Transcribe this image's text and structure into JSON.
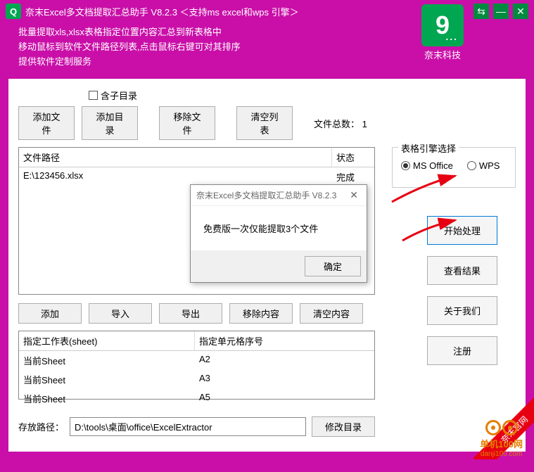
{
  "titlebar": {
    "title": "奈末Excel多文档提取汇总助手  V8.2.3  ＜支持ms  excel和wps 引擎＞",
    "icon_letter": "Q"
  },
  "logo": {
    "letter": "9",
    "brand": "奈末科技"
  },
  "header": {
    "line1": "批量提取xls,xlsx表格指定位置内容汇总到新表格中",
    "line2": "移动鼠标到软件文件路径列表,点击鼠标右键可对其排序",
    "line3": "提供软件定制服务"
  },
  "checkbox": {
    "include_sub": "含子目录"
  },
  "toolbar": {
    "add_file": "添加文件",
    "add_dir": "添加目录",
    "remove_file": "移除文件",
    "clear_list": "清空列表",
    "file_count_label": "文件总数：",
    "file_count_value": "1"
  },
  "file_table": {
    "col_path": "文件路径",
    "col_status": "状态",
    "rows": [
      {
        "path": "E:\\123456.xlsx",
        "status": "完成"
      }
    ]
  },
  "engine": {
    "title": "表格引擎选择",
    "ms": "MS Office",
    "wps": "WPS",
    "selected": "ms"
  },
  "actions": {
    "start": "开始处理",
    "view": "查看结果",
    "about": "关于我们",
    "register": "注册"
  },
  "ops_row": {
    "add": "添加",
    "import": "导入",
    "export": "导出",
    "remove_content": "移除内容",
    "clear_content": "清空内容"
  },
  "sheet_table": {
    "col_sheet": "指定工作表(sheet)",
    "col_cell": "指定单元格序号",
    "rows": [
      {
        "sheet": "当前Sheet",
        "cell": "A2"
      },
      {
        "sheet": "当前Sheet",
        "cell": "A3"
      },
      {
        "sheet": "当前Sheet",
        "cell": "A5"
      }
    ]
  },
  "save": {
    "label": "存放路径：",
    "value": "D:\\tools\\桌面\\office\\ExcelExtractor",
    "change_btn": "修改目录"
  },
  "modal": {
    "title": "奈末Excel多文档提取汇总助手  V8.2.3",
    "body": "免费版一次仅能提取3个文件",
    "ok": "确定"
  },
  "ribbon": {
    "text": "奈末官网"
  },
  "watermark": {
    "name": "单机100网",
    "url": "danji100.com"
  }
}
